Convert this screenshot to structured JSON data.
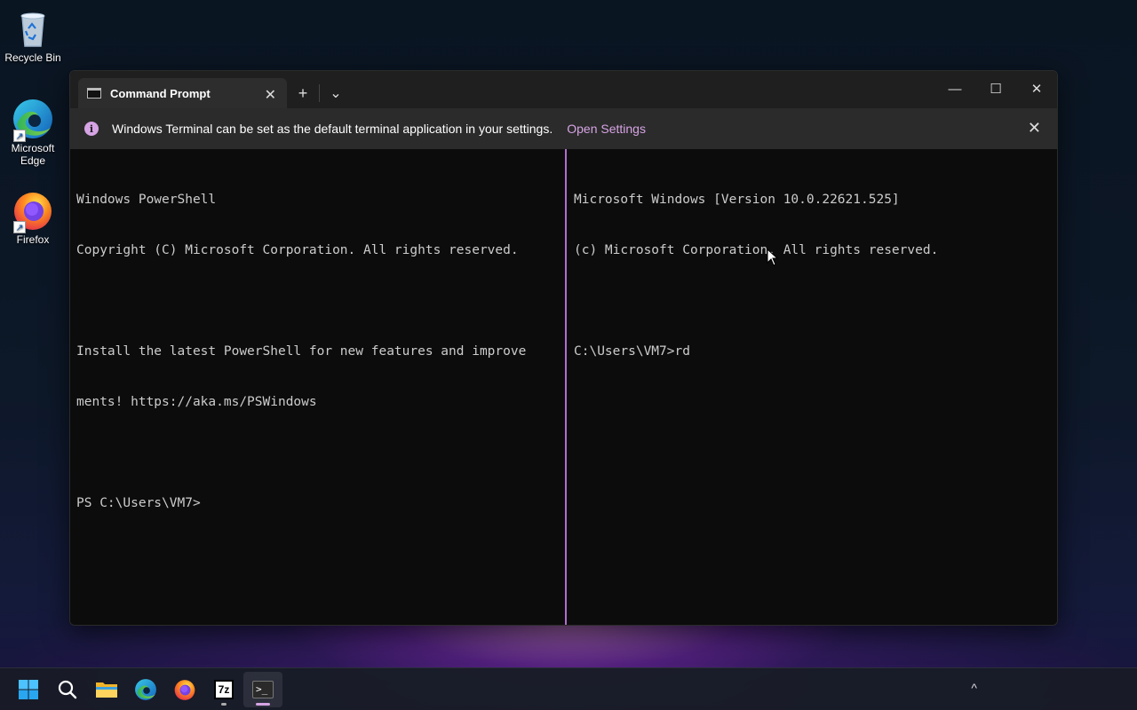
{
  "desktop": {
    "icons": [
      {
        "label": "Recycle Bin",
        "icon": "recycle-bin-icon"
      },
      {
        "label": "Microsoft Edge",
        "icon": "edge-icon"
      },
      {
        "label": "Firefox",
        "icon": "firefox-icon"
      }
    ]
  },
  "window": {
    "tab_title": "Command Prompt",
    "tab_close": "✕",
    "new_tab": "+",
    "dropdown": "⌄",
    "minimize": "—",
    "maximize": "☐",
    "close": "✕"
  },
  "infobar": {
    "message": "Windows Terminal can be set as the default terminal application in your settings.",
    "link": "Open Settings",
    "close": "✕"
  },
  "left_pane": {
    "lines": [
      "Windows PowerShell",
      "Copyright (C) Microsoft Corporation. All rights reserved.",
      "",
      "Install the latest PowerShell for new features and improve",
      "ments! https://aka.ms/PSWindows",
      "",
      "PS C:\\Users\\VM7>"
    ]
  },
  "right_pane": {
    "lines": [
      "Microsoft Windows [Version 10.0.22621.525]",
      "(c) Microsoft Corporation. All rights reserved.",
      "",
      "C:\\Users\\VM7>rd"
    ]
  },
  "colors": {
    "accent": "#b36cd1",
    "info_link": "#d6a4e4",
    "terminal_bg": "#0c0c0c",
    "terminal_text": "#cccccc"
  },
  "taskbar": {
    "items": [
      "start-icon",
      "search-icon",
      "file-explorer-icon",
      "edge-icon",
      "firefox-icon",
      "7zip-icon",
      "terminal-icon"
    ],
    "sevenzip_label": "7z",
    "terminal_label": ">_",
    "tray_chevron": "^"
  }
}
